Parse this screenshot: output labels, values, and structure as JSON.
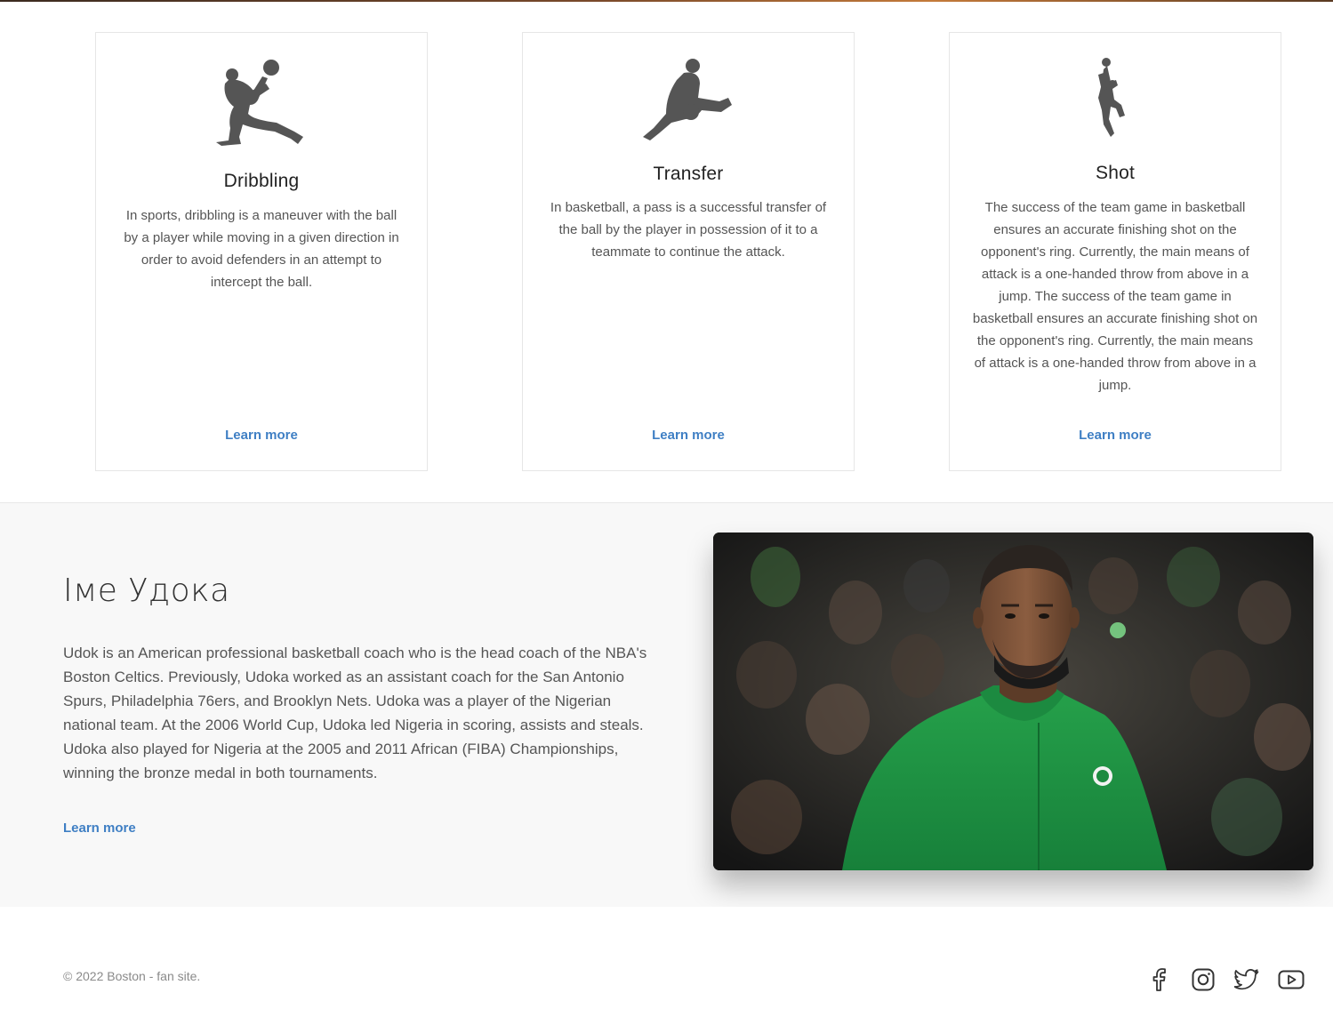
{
  "cards": [
    {
      "title": "Dribbling",
      "text": "In sports, dribbling is a maneuver with the ball by a player while moving in a given direction in order to avoid defenders in an attempt to intercept the ball.",
      "link": "Learn more",
      "icon": "dribbling-player-icon"
    },
    {
      "title": "Transfer",
      "text": "In basketball, a pass is a successful transfer of the ball by the player in possession of it to a teammate to continue the attack.",
      "link": "Learn more",
      "icon": "passing-player-icon"
    },
    {
      "title": "Shot",
      "text": "The success of the team game in basketball ensures an accurate finishing shot on the opponent's ring. Currently, the main means of attack is a one-handed throw from above in a jump. The success of the team game in basketball ensures an accurate finishing shot on the opponent's ring. Currently, the main means of attack is a one-handed throw from above in a jump.",
      "link": "Learn more",
      "icon": "shooting-player-icon"
    }
  ],
  "coach": {
    "name": "Іме Удока",
    "bio": "Udok is an American professional basketball coach who is the head coach of the NBA's Boston Celtics. Previously, Udoka worked as an assistant coach for the San Antonio Spurs, Philadelphia 76ers, and Brooklyn Nets. Udoka was a player of the Nigerian national team. At the 2006 World Cup, Udoka led Nigeria in scoring, assists and steals. Udoka also played for Nigeria at the 2005 and 2011 African (FIBA) Championships, winning the bronze medal in both tournaments.",
    "link": "Learn more"
  },
  "footer": {
    "copyright": "© 2022 Boston - fan site.",
    "social": [
      "facebook-icon",
      "instagram-icon",
      "twitter-icon",
      "youtube-icon"
    ]
  },
  "colors": {
    "link": "#3f7fc4",
    "icon": "#555555",
    "jersey": "#1f8f3f",
    "section_bg": "#f8f8f8"
  }
}
